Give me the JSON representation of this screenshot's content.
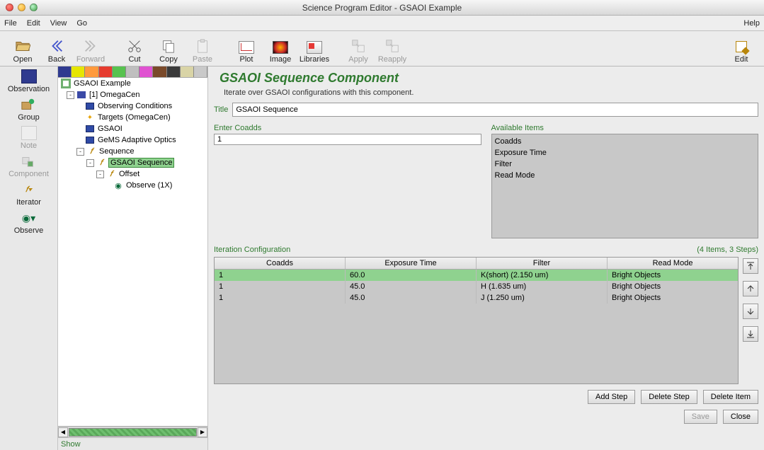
{
  "window": {
    "title": "Science Program Editor - GSAOI Example"
  },
  "menu": {
    "file": "File",
    "edit": "Edit",
    "view": "View",
    "go": "Go",
    "help": "Help"
  },
  "toolbar": {
    "open": "Open",
    "back": "Back",
    "forward": "Forward",
    "cut": "Cut",
    "copy": "Copy",
    "paste": "Paste",
    "plot": "Plot",
    "image": "Image",
    "libraries": "Libraries",
    "apply": "Apply",
    "reapply": "Reapply",
    "edit": "Edit"
  },
  "palette": {
    "observation": "Observation",
    "group": "Group",
    "note": "Note",
    "component": "Component",
    "iterator": "Iterator",
    "observe": "Observe"
  },
  "colorstrip": [
    "#2f3a8f",
    "#e6e600",
    "#ff9a3c",
    "#e63b2e",
    "#57c24f",
    "#bfbfbf",
    "#e052d1",
    "#7a4a2a",
    "#3a3a3a",
    "#d9d4a6",
    "#c9c9c9"
  ],
  "tree": {
    "root": "GSAOI Example",
    "n1": "[1] OmegaCen",
    "n1_children": [
      "Observing Conditions",
      "Targets (OmegaCen)",
      "GSAOI",
      "GeMS Adaptive Optics",
      "Sequence"
    ],
    "seq_child": "GSAOI Sequence",
    "offset": "Offset",
    "observe": "Observe (1X)"
  },
  "show_label": "Show",
  "component": {
    "title": "GSAOI Sequence Component",
    "desc": "Iterate over GSAOI configurations with this component.",
    "title_field_label": "Title",
    "title_field_value": "GSAOI Sequence",
    "coadds_label": "Enter Coadds",
    "coadds_value": "1",
    "avail_label": "Available Items",
    "avail_items": [
      "Coadds",
      "Exposure Time",
      "Filter",
      "Read Mode"
    ],
    "iter_label": "Iteration Configuration",
    "iter_count": "(4 Items, 3 Steps)",
    "headers": [
      "Coadds",
      "Exposure Time",
      "Filter",
      "Read Mode"
    ],
    "rows": [
      [
        "1",
        "60.0",
        "K(short) (2.150 um)",
        "Bright Objects"
      ],
      [
        "1",
        "45.0",
        "H (1.635 um)",
        "Bright Objects"
      ],
      [
        "1",
        "45.0",
        "J (1.250 um)",
        "Bright Objects"
      ]
    ],
    "buttons": {
      "add_step": "Add Step",
      "delete_step": "Delete Step",
      "delete_item": "Delete Item",
      "save": "Save",
      "close": "Close"
    }
  }
}
